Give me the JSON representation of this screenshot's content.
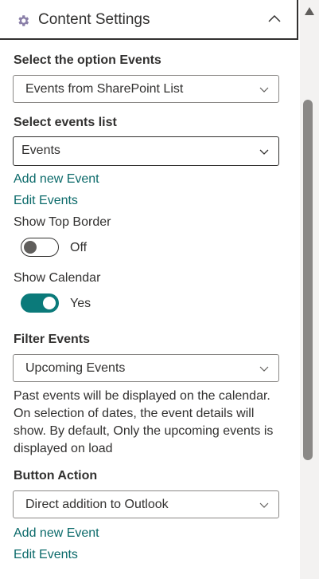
{
  "header": {
    "title": "Content Settings",
    "icon": "gear-icon",
    "collapse_icon": "chevron-up-icon"
  },
  "option_events": {
    "label": "Select the option Events",
    "value": "Events from SharePoint List"
  },
  "events_list": {
    "label": "Select events list",
    "value": "Events"
  },
  "links_top": {
    "add": "Add new Event",
    "edit": "Edit Events"
  },
  "show_top_border": {
    "label": "Show Top Border",
    "state": "Off",
    "on": false
  },
  "show_calendar": {
    "label": "Show Calendar",
    "state": "Yes",
    "on": true
  },
  "filter_events": {
    "label": "Filter Events",
    "value": "Upcoming Events",
    "description": "Past events will be displayed on the calendar. On selection of dates, the event details will show. By default, Only the upcoming events is displayed on load"
  },
  "button_action": {
    "label": "Button Action",
    "value": "Direct addition to Outlook"
  },
  "links_bottom": {
    "add": "Add new Event",
    "edit": "Edit Events"
  },
  "colors": {
    "accent": "#0b7a7a",
    "link": "#0b6a6a",
    "text": "#323130",
    "border": "#8a8886"
  }
}
